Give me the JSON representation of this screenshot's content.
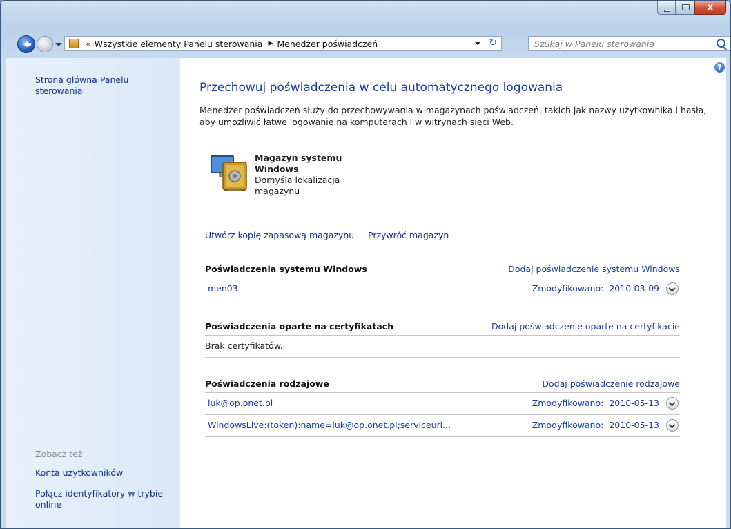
{
  "window": {
    "close_glyph": "x"
  },
  "nav": {
    "breadcrumb_chevron": "«",
    "crumbs": [
      "Wszystkie elementy Panelu sterowania",
      "Menedżer poświadczeń"
    ],
    "crumb_separator": "▶",
    "refresh_glyph": "↻",
    "search_placeholder": "Szukaj w Panelu sterowania"
  },
  "sidebar": {
    "home_link": "Strona główna Panelu sterowania",
    "see_also_heading": "Zobacz też",
    "see_also_links": [
      "Konta użytkowników",
      "Połącz identyfikatory w trybie online"
    ]
  },
  "help_glyph": "?",
  "main": {
    "title": "Przechowuj poświadczenia w celu automatycznego logowania",
    "description": "Menedżer poświadczeń służy do przechowywania w magazynach poświadczeń, takich jak nazwy użytkownika i hasła, aby umożliwić łatwe logowanie na komputerach i w witrynach sieci Web.",
    "vault": {
      "name": "Magazyn systemu Windows",
      "subtitle": "Domyśla lokalizacja magazynu"
    },
    "backup_link": "Utwórz kopię zapasową magazynu",
    "restore_link": "Przywróć magazyn",
    "sections": [
      {
        "title": "Poświadczenia systemu Windows",
        "add_link": "Dodaj poświadczenie systemu Windows",
        "rows": [
          {
            "name": "men03",
            "modified_label": "Zmodyfikowano:",
            "date": "2010-03-09"
          }
        ]
      },
      {
        "title": "Poświadczenia oparte na certyfikatach",
        "add_link": "Dodaj poświadczenie oparte na certyfikacie",
        "empty_text": "Brak certyfikatów."
      },
      {
        "title": "Poświadczenia rodzajowe",
        "add_link": "Dodaj poświadczenie rodzajowe",
        "rows": [
          {
            "name": "luk@op.onet.pl",
            "modified_label": "Zmodyfikowano:",
            "date": "2010-05-13"
          },
          {
            "name": "WindowsLive:(token):name=luk@op.onet.pl;serviceuri...",
            "modified_label": "Zmodyfikowano:",
            "date": "2010-05-13"
          }
        ]
      }
    ]
  }
}
